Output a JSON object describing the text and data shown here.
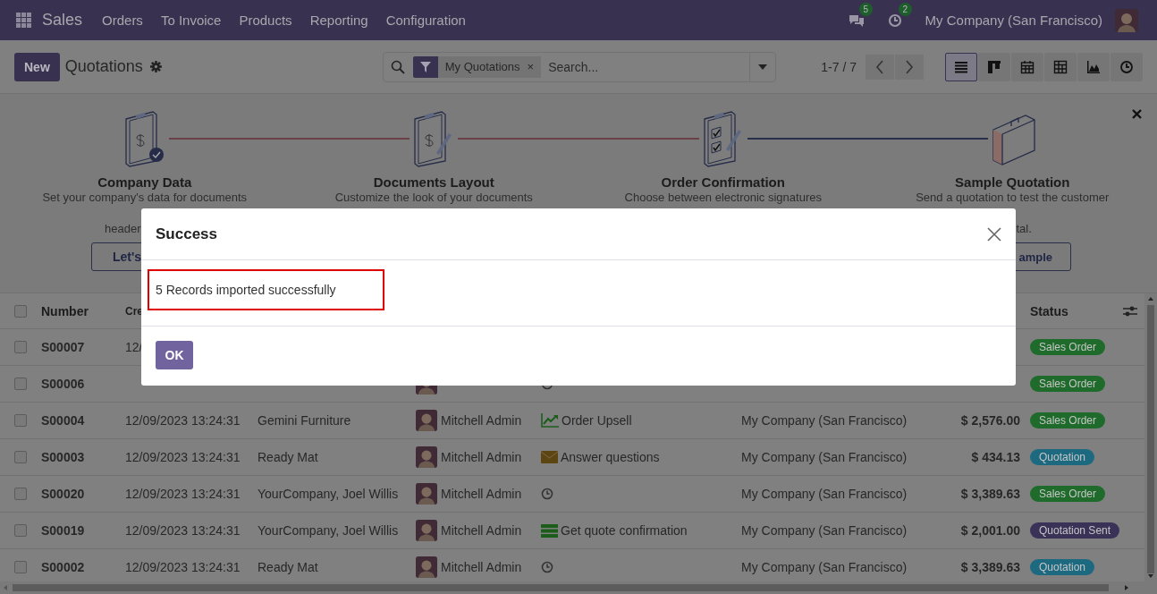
{
  "navbar": {
    "app": "Sales",
    "menu": [
      "Orders",
      "To Invoice",
      "Products",
      "Reporting",
      "Configuration"
    ],
    "messages_badge": "5",
    "activities_badge": "2",
    "company": "My Company (San Francisco)"
  },
  "control_panel": {
    "new_button": "New",
    "title": "Quotations",
    "facet": "My Quotations",
    "facet_remove": "×",
    "search_placeholder": "Search...",
    "pager": "1-7 / 7",
    "views": [
      {
        "kind": "list",
        "selected": true
      },
      {
        "kind": "kanban",
        "selected": false
      },
      {
        "kind": "calendar",
        "selected": false
      },
      {
        "kind": "pivot",
        "selected": false
      },
      {
        "kind": "graph",
        "selected": false
      },
      {
        "kind": "activity",
        "selected": false
      }
    ]
  },
  "onboarding": {
    "steps": [
      {
        "kind": "clipboard-check",
        "title": "Company Data",
        "description": "Set your company's data for documents",
        "description_end": "header",
        "button": "Let's"
      },
      {
        "kind": "clipboard-pen",
        "title": "Documents Layout",
        "description": "Customize the look of your documents"
      },
      {
        "kind": "checklist",
        "title": "Order Confirmation",
        "description": "Choose between electronic signatures"
      },
      {
        "kind": "briefcase",
        "title": "Sample Quotation",
        "description": "Send a quotation to test the customer",
        "description_end": "tal.",
        "button": "ample"
      }
    ]
  },
  "table": {
    "select_all_checked": false,
    "header": {
      "number": "Number",
      "column_2": "Cre",
      "status": "Status"
    },
    "rows": [
      {
        "checked": false,
        "number": "S00007",
        "created": "12/",
        "status": {
          "label": "Sales Order",
          "color": "#1f6b2b"
        }
      },
      {
        "checked": false,
        "number": "S00006",
        "avatar": true,
        "activity": {
          "kind": "clock"
        },
        "status": {
          "label": "Sales Order",
          "color": "#1f6b2b"
        }
      },
      {
        "checked": false,
        "number": "S00004",
        "created": "12/09/2023 13:24:31",
        "customer": "Gemini Furniture",
        "salesperson": "Mitchell Admin",
        "activity": {
          "kind": "trend",
          "text": "Order Upsell"
        },
        "company": "My Company (San Francisco)",
        "total": "$ 2,576.00",
        "status": {
          "label": "Sales Order",
          "color": "#1f6b2b"
        }
      },
      {
        "checked": false,
        "number": "S00003",
        "created": "12/09/2023 13:24:31",
        "customer": "Ready Mat",
        "salesperson": "Mitchell Admin",
        "activity": {
          "kind": "email",
          "text": "Answer questions"
        },
        "company": "My Company (San Francisco)",
        "total": "$ 434.13",
        "status": {
          "label": "Quotation",
          "color": "#1d6a80"
        }
      },
      {
        "checked": false,
        "number": "S00020",
        "created": "12/09/2023 13:24:31",
        "customer": "YourCompany, Joel Willis",
        "salesperson": "Mitchell Admin",
        "activity": {
          "kind": "clock"
        },
        "company": "My Company (San Francisco)",
        "total": "$ 3,389.63",
        "status": {
          "label": "Sales Order",
          "color": "#1f6b2b"
        }
      },
      {
        "checked": false,
        "number": "S00019",
        "created": "12/09/2023 13:24:31",
        "customer": "YourCompany, Joel Willis",
        "salesperson": "Mitchell Admin",
        "activity": {
          "kind": "todo",
          "text": "Get quote confirmation"
        },
        "company": "My Company (San Francisco)",
        "total": "$ 2,001.00",
        "status": {
          "label": "Quotation Sent",
          "color": "#3a3357"
        }
      },
      {
        "checked": false,
        "number": "S00002",
        "created": "12/09/2023 13:24:31",
        "customer": "Ready Mat",
        "salesperson": "Mitchell Admin",
        "activity": {
          "kind": "clock"
        },
        "company": "My Company (San Francisco)",
        "total": "$ 3,389.63",
        "status": {
          "label": "Quotation",
          "color": "#1d6a80"
        }
      }
    ]
  },
  "dialog": {
    "title": "Success",
    "message": "5 Records imported successfully",
    "ok": "OK"
  }
}
